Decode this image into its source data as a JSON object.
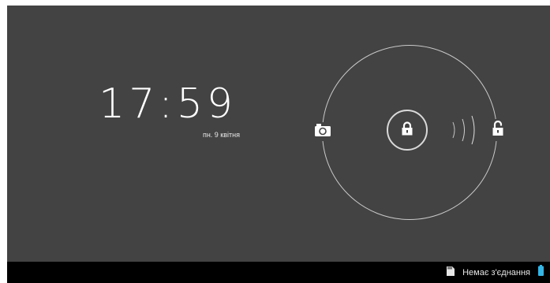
{
  "lockscreen": {
    "time": "17:59",
    "date": "пн. 9 квітня",
    "handle_icon": "lock-icon",
    "targets": [
      {
        "name": "camera-target",
        "icon": "camera-icon"
      },
      {
        "name": "unlock-target",
        "icon": "unlock-icon"
      }
    ]
  },
  "statusbar": {
    "sd_icon": "sd-card-icon",
    "network_text": "Немає з'єднання",
    "battery_icon": "battery-icon"
  },
  "colors": {
    "background": "#434343",
    "ring": "#c9c9c9",
    "statusbar": "#000000",
    "battery": "#33b5e5"
  }
}
